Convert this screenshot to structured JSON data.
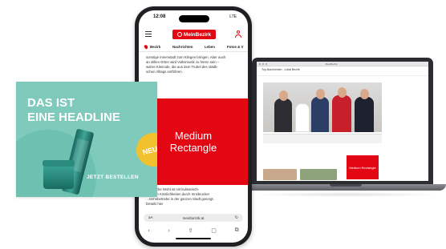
{
  "laptop": {
    "browser_title": "MeinBezirk",
    "site_breadcrumb": "Top-Nachrichten - Lokal Bezirk",
    "ad_label": "Medium Rectangle"
  },
  "phone": {
    "status_time": "12:08",
    "status_right": "LTE",
    "brand": "MeinBezirk",
    "nav": {
      "location": "Bezirk",
      "items": [
        "Nachrichten",
        "Leben",
        "Fotos & V"
      ]
    },
    "article_top": [
      "sonstige Innenstadt zum Klingen bringen. Aber auch",
      "an stillen Orten wird Volksmusik zu hören sein –",
      "wahre Kleinode, die aus dem Trubel des städti-",
      "schen Alltags entführen."
    ],
    "ad_label": [
      "Medium",
      "Rectangle"
    ],
    "article_bottom": [
      "…leibliche Wohl ist mit kulinarisch-",
      "…schen Köstlichkeiten durch Innsbrucker",
      "…ternebetriebe in der ganzen Stadt gesorgt.",
      "Details hier"
    ],
    "url": "meinbezirk.at",
    "url_left": "aA",
    "url_reload": "↻",
    "toolbar": [
      "‹",
      "›",
      "⇪",
      "▢",
      "⧉"
    ]
  },
  "banner": {
    "headline": [
      "DAS IST",
      "EINE HEADLINE"
    ],
    "badge": "NEU",
    "cta": "JETZT BESTELLEN"
  },
  "colors": {
    "brand_red": "#e30613",
    "banner_teal": "#7fcabb",
    "badge_yellow": "#f2c12e"
  }
}
